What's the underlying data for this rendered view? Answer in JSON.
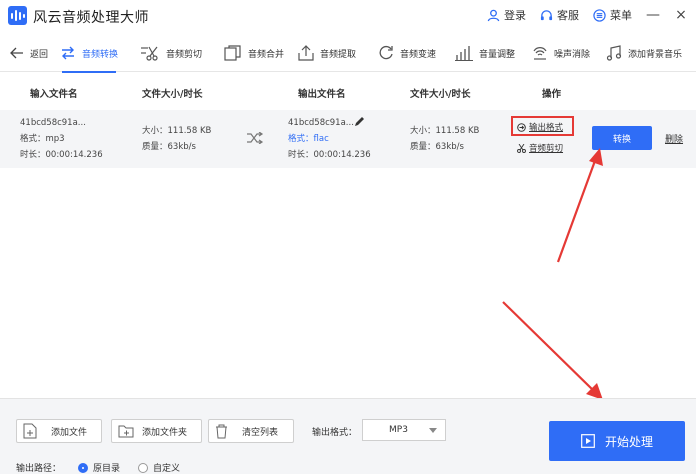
{
  "app": {
    "title": "风云音频处理大师"
  },
  "titlebar": {
    "login": "登录",
    "service": "客服",
    "menu": "菜单",
    "minimize": "—",
    "close": "×"
  },
  "toolbar": {
    "back": "返回",
    "tabs": [
      {
        "label": "音频转换",
        "icon": "convert-icon",
        "active": true
      },
      {
        "label": "音频剪切",
        "icon": "scissors-icon"
      },
      {
        "label": "音频合并",
        "icon": "merge-icon"
      },
      {
        "label": "音频提取",
        "icon": "extract-icon"
      },
      {
        "label": "音频变速",
        "icon": "speed-icon"
      },
      {
        "label": "音量调整",
        "icon": "volume-bars-icon"
      },
      {
        "label": "噪声消除",
        "icon": "noise-icon"
      },
      {
        "label": "添加背景音乐",
        "icon": "music-note-icon"
      }
    ]
  },
  "table": {
    "headers": [
      "输入文件名",
      "文件大小/时长",
      "输出文件名",
      "文件大小/时长",
      "操作"
    ],
    "row": {
      "input_name": "41bcd58c91a...",
      "input_format": "格式：mp3",
      "input_duration": "时长：00:00:14.236",
      "input_size": "大小：111.58 KB",
      "input_quality": "质量：63kb/s",
      "output_name": "41bcd58c91a...",
      "output_format": "格式：flac",
      "output_duration": "时长：00:00:14.236",
      "output_size": "大小：111.58 KB",
      "output_quality": "质量：63kb/s",
      "op_output_format": "输出格式",
      "op_cut": "音频剪切",
      "convert": "转换",
      "delete": "删除"
    }
  },
  "bottom": {
    "add_file": "添加文件",
    "add_folder": "添加文件夹",
    "clear_list": "清空列表",
    "format_label": "输出格式：",
    "format_value": "MP3",
    "start": "开始处理",
    "path_label": "输出路径：",
    "path_options": [
      "原目录",
      "自定义"
    ],
    "path_selected": "原目录"
  },
  "colors": {
    "accent": "#2f6df6",
    "annotation": "#e53935",
    "row_bg": "#f4f5f7"
  }
}
